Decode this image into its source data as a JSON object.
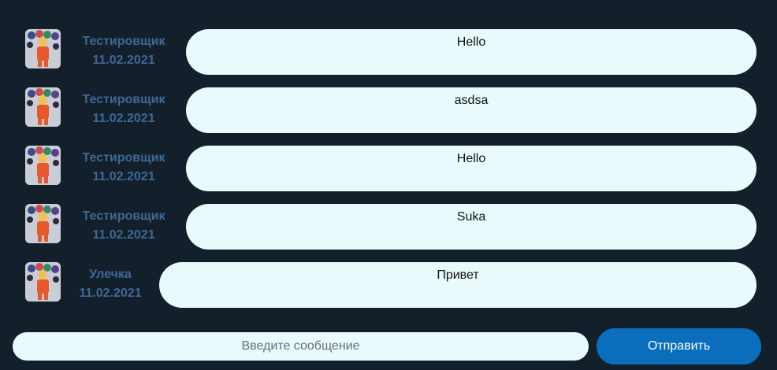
{
  "messages": [
    {
      "author": "Тестировщик",
      "date": "11.02.2021",
      "text": "Hello"
    },
    {
      "author": "Тестировщик",
      "date": "11.02.2021",
      "text": "asdsa"
    },
    {
      "author": "Тестировщик",
      "date": "11.02.2021",
      "text": "Hello"
    },
    {
      "author": "Тестировщик",
      "date": "11.02.2021",
      "text": "Suka"
    },
    {
      "author": "Улечка",
      "date": "11.02.2021",
      "text": "Привет"
    }
  ],
  "composer": {
    "placeholder": "Введите сообщение",
    "value": "",
    "send_label": "Отправить"
  },
  "colors": {
    "background": "#13202c",
    "bubble": "#e8fafb",
    "meta_text": "#3e6896",
    "send_button": "#0a6ebd"
  },
  "icons": {
    "avatar": "user-avatar-photo"
  }
}
